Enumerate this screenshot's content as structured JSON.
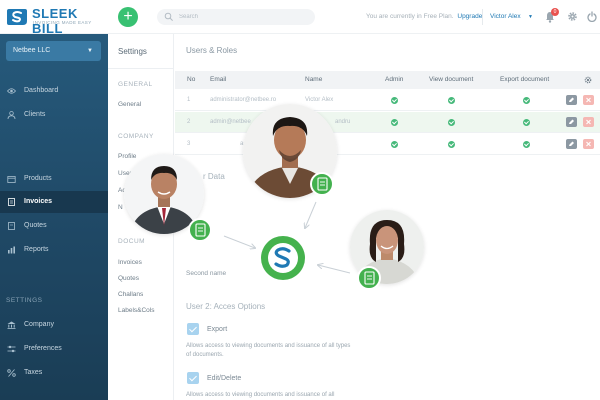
{
  "brand": {
    "name": "SLEEK BILL",
    "tagline": "INVOICING MADE EASY"
  },
  "header": {
    "add_label": "+",
    "search_placeholder": "Search",
    "plan_text": "You are currently in Free Plan.",
    "upgrade_label": "Upgrade",
    "user_name": "Victor Alex",
    "notification_count": "0"
  },
  "sidebar": {
    "company": "Netbee LLC",
    "items": [
      {
        "label": "Dashboard",
        "icon": "eye-icon"
      },
      {
        "label": "Clients",
        "icon": "user-icon"
      },
      {
        "label": "Products",
        "icon": "box-icon"
      },
      {
        "label": "Invoices",
        "icon": "document-icon",
        "active": true
      },
      {
        "label": "Quotes",
        "icon": "document-icon"
      },
      {
        "label": "Reports",
        "icon": "chart-icon"
      }
    ],
    "settings_heading": "SETTINGS",
    "settings_items": [
      {
        "label": "Company",
        "icon": "bank-icon"
      },
      {
        "label": "Preferences",
        "icon": "sliders-icon"
      },
      {
        "label": "Taxes",
        "icon": "percent-icon"
      }
    ]
  },
  "settings_menu": {
    "title": "Settings",
    "general_heading": "GENERAL",
    "general_items": [
      "General"
    ],
    "company_heading": "COMPANY",
    "company_items": [
      "Profile",
      "Users",
      "Ac",
      "N"
    ],
    "documents_heading": "DOCUM",
    "documents_items": [
      "Invoices",
      "Quotes",
      "Challans",
      "Labels&Cols"
    ]
  },
  "content": {
    "title": "Users & Roles",
    "table": {
      "headers": [
        "No",
        "Email",
        "Name",
        "Admin",
        "View document",
        "Export document"
      ],
      "rows": [
        {
          "no": "1",
          "email": "administrator@netbee.ro",
          "name": "Victor Alex"
        },
        {
          "no": "2",
          "email": "admin@netbee",
          "name": "andru"
        },
        {
          "no": "3",
          "email": "admin@net",
          "name": ""
        }
      ]
    },
    "user_data_label": "r Data",
    "second_name_label": "Second name",
    "access_title": "User 2: Acces Options",
    "options": [
      {
        "name": "Export",
        "desc": "Allows access to viewing documents and issuance of all types of documents."
      },
      {
        "name": "Edit/Delete",
        "desc": "Allows access to viewing documents and issuance of all"
      }
    ]
  },
  "colors": {
    "brand_blue": "#1f79b4",
    "sidebar_dark": "#1f4865",
    "accent_green": "#45b24d",
    "check_green": "#46b97a",
    "alert_red": "#e9524f"
  }
}
